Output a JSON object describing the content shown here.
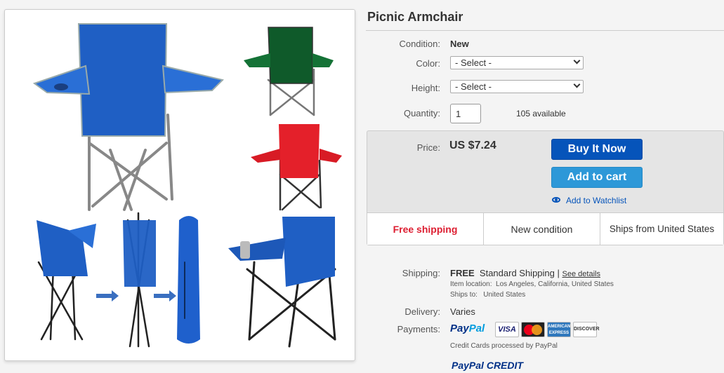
{
  "product": {
    "title": "Picnic Armchair",
    "image_alt": "Folding picnic armchairs in blue, green and red"
  },
  "details": {
    "condition_label": "Condition:",
    "condition_value": "New",
    "color_label": "Color:",
    "color_select": "- Select -",
    "height_label": "Height:",
    "height_select": "- Select -",
    "quantity_label": "Quantity:",
    "quantity_value": "1",
    "available": "105 available"
  },
  "purchase": {
    "price_label": "Price:",
    "price": "US $7.24",
    "buy_now": "Buy It Now",
    "add_to_cart": "Add to cart",
    "watchlist": "Add to Watchlist"
  },
  "highlights": [
    "Free shipping",
    "New condition",
    "Ships from United States"
  ],
  "shipping": {
    "label": "Shipping:",
    "free": "FREE",
    "method": "Standard Shipping",
    "sep": "|",
    "see_details": "See details",
    "location_label": "Item location:",
    "location": "Los Angeles, California, United States",
    "ships_to_label": "Ships to:",
    "ships_to": "United States"
  },
  "delivery": {
    "label": "Delivery:",
    "value": "Varies"
  },
  "payments": {
    "label": "Payments:",
    "paypal_pay": "Pay",
    "paypal_pal": "Pal",
    "cards": [
      "VISA",
      "MasterCard",
      "AMERICAN EXPRESS",
      "DISCOVER"
    ],
    "note": "Credit Cards processed by PayPal",
    "credit_pay": "PayPal",
    "credit_word": "CREDIT"
  },
  "colors": {
    "blue": "#0654ba",
    "free_red": "#dd1e31",
    "chair_blue": "#1f5fc4",
    "chair_green": "#0f5a2a",
    "chair_red": "#e4202a"
  }
}
